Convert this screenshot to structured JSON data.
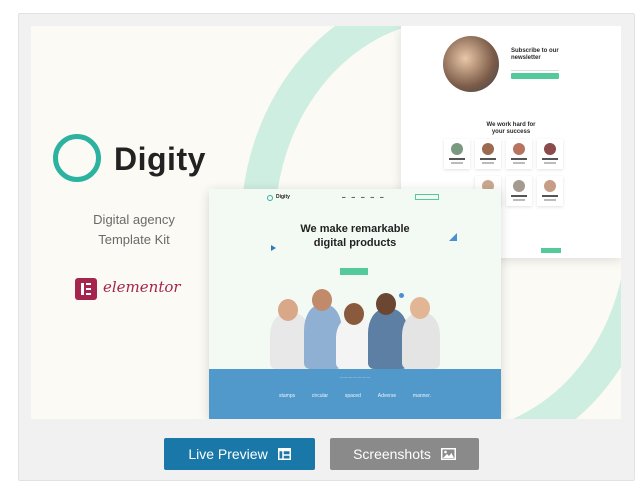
{
  "brand": {
    "name": "Digity",
    "tagline_line1": "Digital agency",
    "tagline_line2": "Template Kit",
    "builder": "elementor"
  },
  "mockup_back": {
    "newsletter_title_line1": "Subscribe to our",
    "newsletter_title_line2": "newsletter",
    "section_title_line1": "We work hard for",
    "section_title_line2": "your success"
  },
  "mockup_front": {
    "logo": "Digity",
    "headline_line1": "We make remarkable",
    "headline_line2": "digital products",
    "partners": [
      "stamps",
      "circular",
      "spaced",
      "Adverse",
      "manner."
    ]
  },
  "actions": {
    "live_preview": "Live Preview",
    "screenshots": "Screenshots"
  },
  "colors": {
    "accent_teal": "#2bb3a0",
    "live_preview_bg": "#1a78a8",
    "screenshots_bg": "#8a8a8a",
    "partners_band": "#5299cb",
    "elementor": "#a4264f"
  },
  "icons": {
    "live_preview": "layout-window-icon",
    "screenshots": "image-icon"
  }
}
